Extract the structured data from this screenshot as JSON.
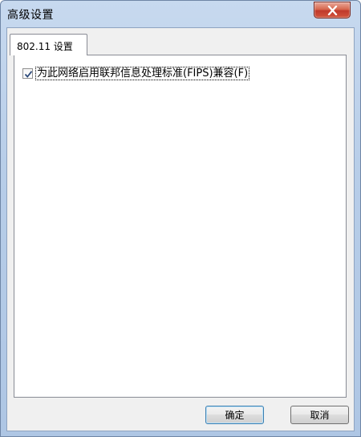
{
  "window": {
    "title": "高级设置"
  },
  "tabs": [
    {
      "label": "802.11 设置"
    }
  ],
  "settings": {
    "fips_checkbox_label": "为此网络启用联邦信息处理标准(FIPS)兼容(F)",
    "fips_checked": true
  },
  "buttons": {
    "ok_label": "确定",
    "cancel_label": "取消"
  }
}
